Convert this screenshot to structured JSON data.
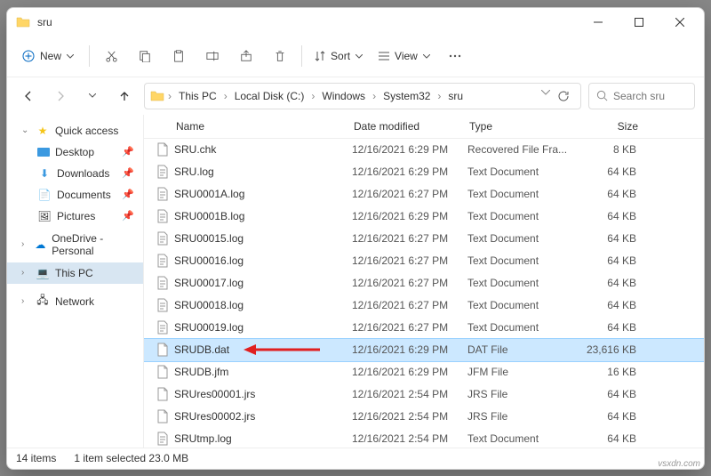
{
  "title": "sru",
  "toolbar": {
    "new": "New",
    "sort": "Sort",
    "view": "View"
  },
  "breadcrumb": [
    "This PC",
    "Local Disk (C:)",
    "Windows",
    "System32",
    "sru"
  ],
  "search": {
    "placeholder": "Search sru"
  },
  "sidebar": {
    "quick": "Quick access",
    "desktop": "Desktop",
    "downloads": "Downloads",
    "documents": "Documents",
    "pictures": "Pictures",
    "onedrive": "OneDrive - Personal",
    "thispc": "This PC",
    "network": "Network"
  },
  "columns": {
    "name": "Name",
    "date": "Date modified",
    "type": "Type",
    "size": "Size"
  },
  "files": [
    {
      "name": "SRU.chk",
      "date": "12/16/2021 6:29 PM",
      "type": "Recovered File Fra...",
      "size": "8 KB",
      "ic": "file"
    },
    {
      "name": "SRU.log",
      "date": "12/16/2021 6:29 PM",
      "type": "Text Document",
      "size": "64 KB",
      "ic": "txt"
    },
    {
      "name": "SRU0001A.log",
      "date": "12/16/2021 6:27 PM",
      "type": "Text Document",
      "size": "64 KB",
      "ic": "txt"
    },
    {
      "name": "SRU0001B.log",
      "date": "12/16/2021 6:29 PM",
      "type": "Text Document",
      "size": "64 KB",
      "ic": "txt"
    },
    {
      "name": "SRU00015.log",
      "date": "12/16/2021 6:27 PM",
      "type": "Text Document",
      "size": "64 KB",
      "ic": "txt"
    },
    {
      "name": "SRU00016.log",
      "date": "12/16/2021 6:27 PM",
      "type": "Text Document",
      "size": "64 KB",
      "ic": "txt"
    },
    {
      "name": "SRU00017.log",
      "date": "12/16/2021 6:27 PM",
      "type": "Text Document",
      "size": "64 KB",
      "ic": "txt"
    },
    {
      "name": "SRU00018.log",
      "date": "12/16/2021 6:27 PM",
      "type": "Text Document",
      "size": "64 KB",
      "ic": "txt"
    },
    {
      "name": "SRU00019.log",
      "date": "12/16/2021 6:27 PM",
      "type": "Text Document",
      "size": "64 KB",
      "ic": "txt"
    },
    {
      "name": "SRUDB.dat",
      "date": "12/16/2021 6:29 PM",
      "type": "DAT File",
      "size": "23,616 KB",
      "ic": "file",
      "selected": true,
      "arrow": true
    },
    {
      "name": "SRUDB.jfm",
      "date": "12/16/2021 6:29 PM",
      "type": "JFM File",
      "size": "16 KB",
      "ic": "file"
    },
    {
      "name": "SRUres00001.jrs",
      "date": "12/16/2021 2:54 PM",
      "type": "JRS File",
      "size": "64 KB",
      "ic": "file"
    },
    {
      "name": "SRUres00002.jrs",
      "date": "12/16/2021 2:54 PM",
      "type": "JRS File",
      "size": "64 KB",
      "ic": "file"
    },
    {
      "name": "SRUtmp.log",
      "date": "12/16/2021 2:54 PM",
      "type": "Text Document",
      "size": "64 KB",
      "ic": "txt"
    }
  ],
  "status": {
    "count": "14 items",
    "selection": "1 item selected  23.0 MB"
  },
  "watermark": "vsxdn.com"
}
